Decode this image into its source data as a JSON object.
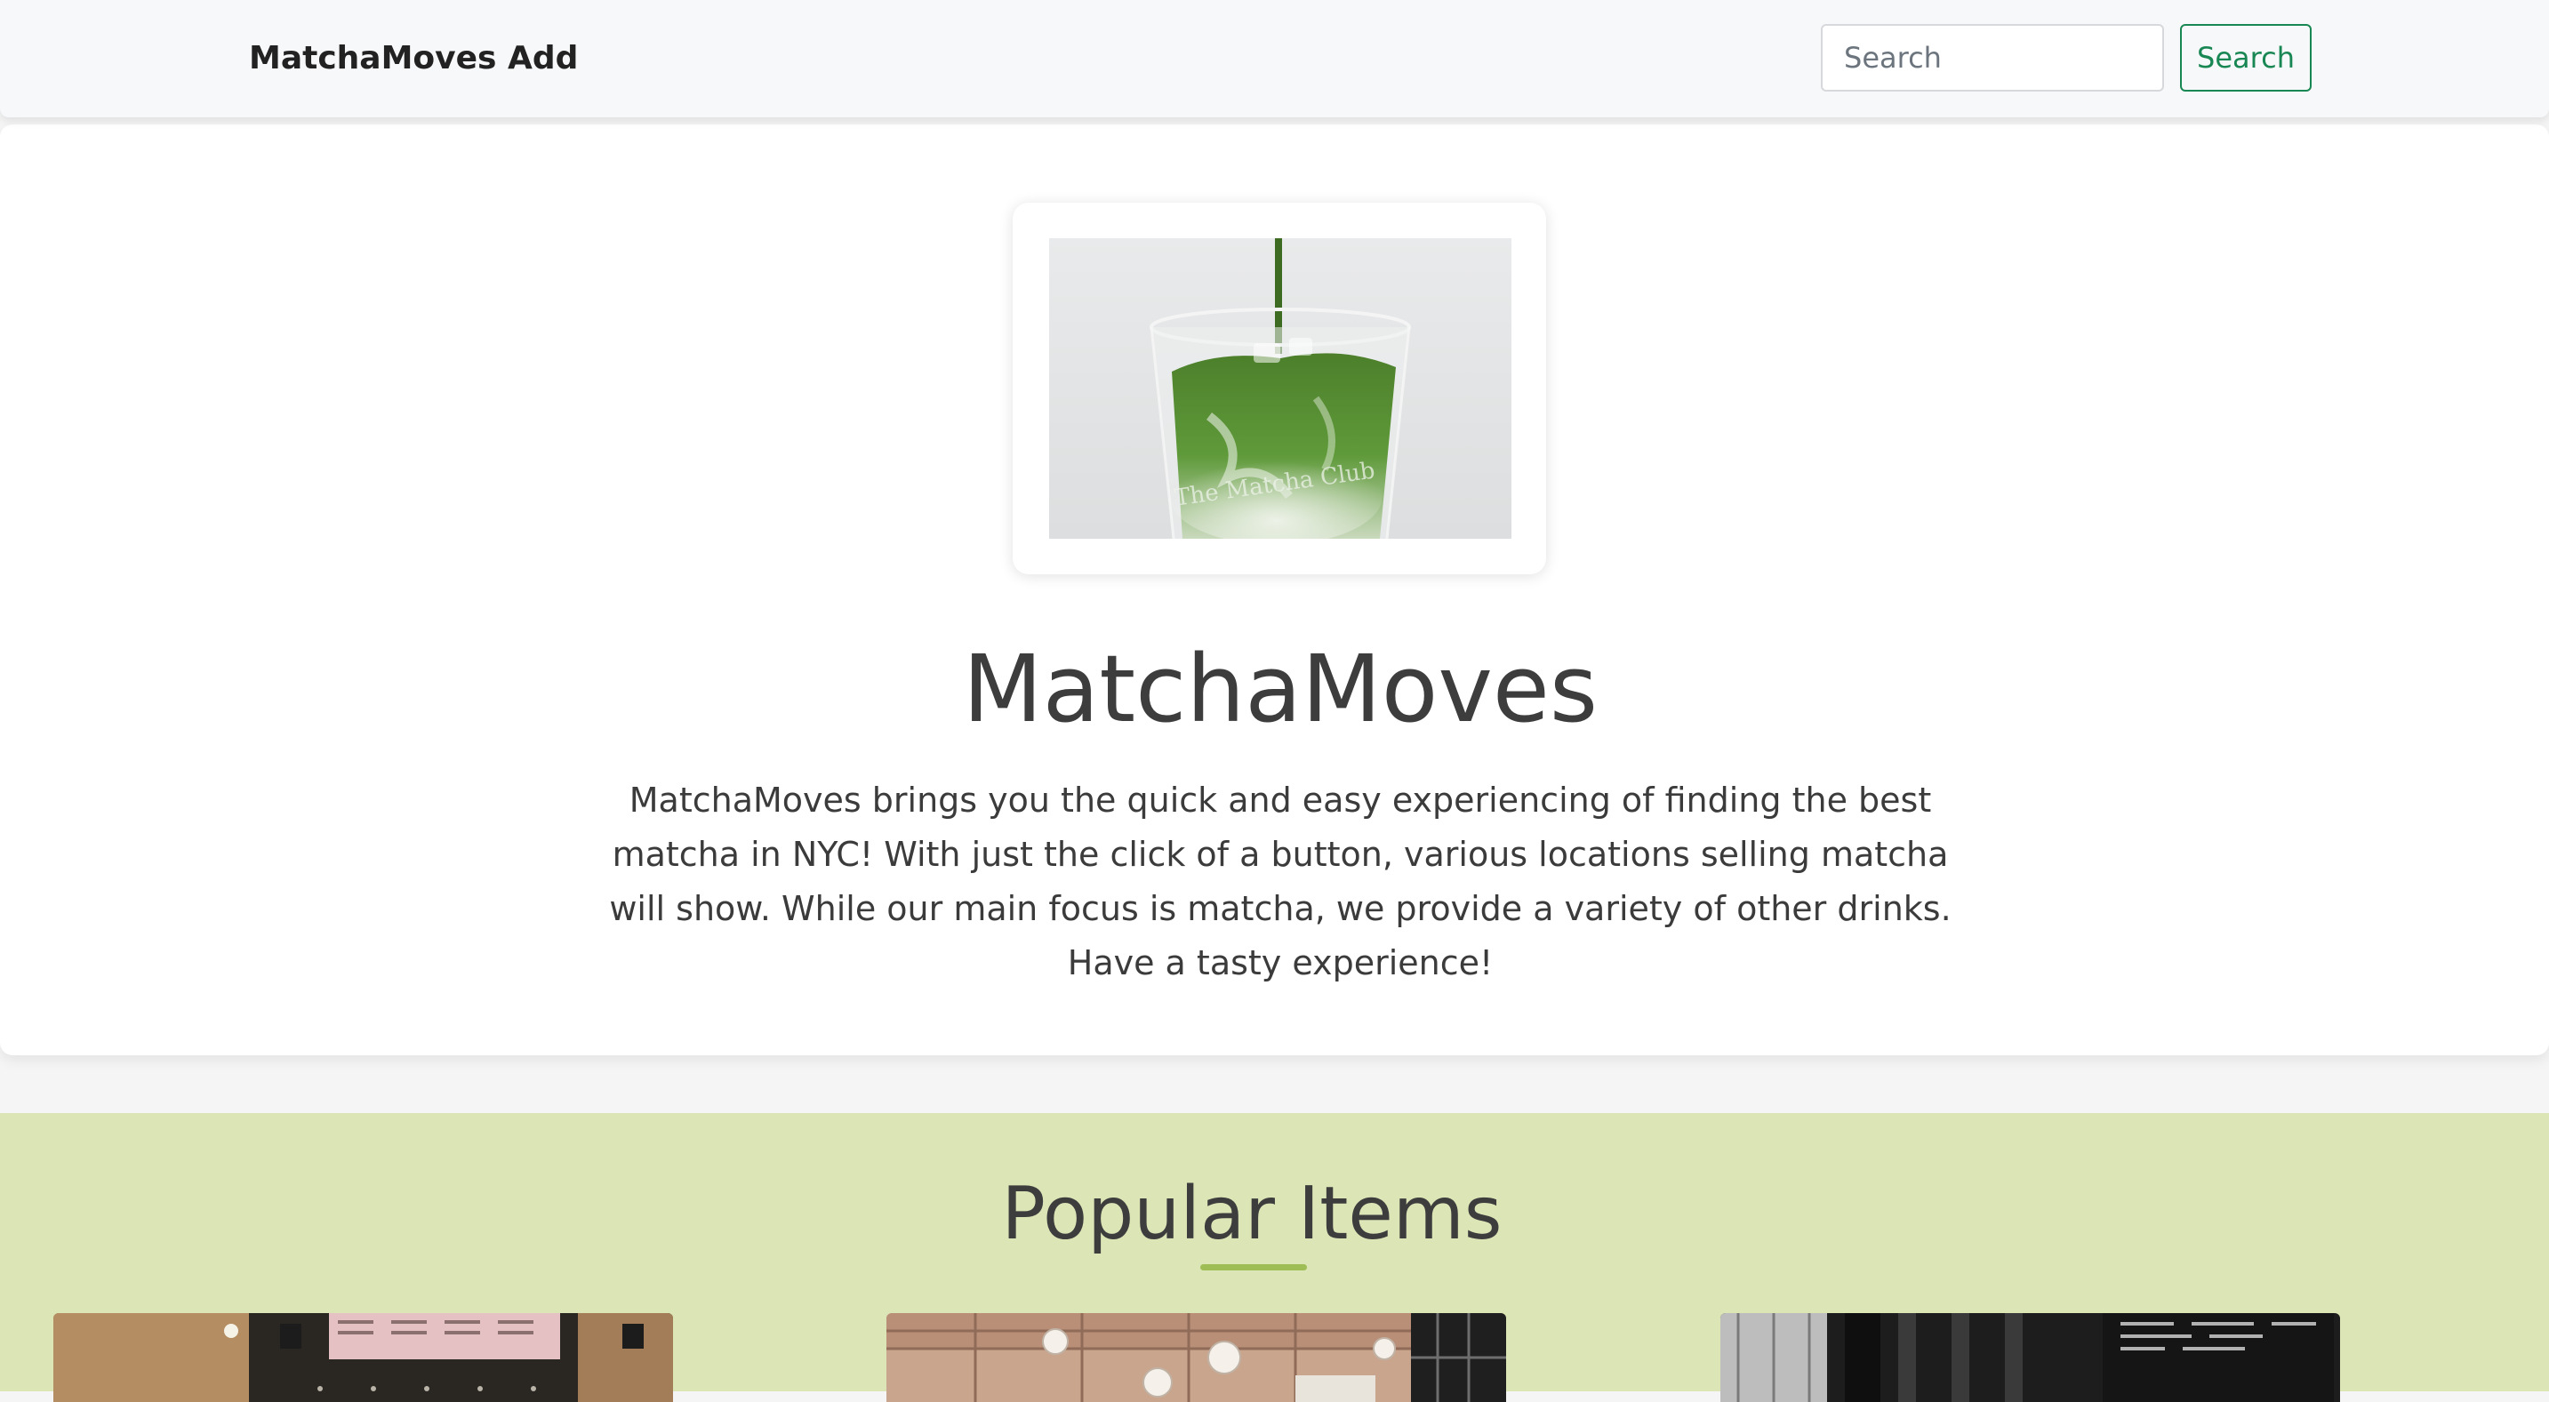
{
  "navbar": {
    "brand": "MatchaMoves",
    "add_link": "Add",
    "search_placeholder": "Search",
    "search_button": "Search"
  },
  "hero": {
    "image_icon": "matcha-latte-image",
    "image_watermark": "The Matcha Club",
    "title": "MatchaMoves",
    "description": "MatchaMoves brings you the quick and easy experiencing of finding the best matcha in NYC! With just the click of a button, various locations selling matcha will show. While our main focus is matcha, we provide a variety of other drinks. Have a tasty experience!"
  },
  "popular": {
    "title": "Popular Items",
    "items": [
      {
        "image_icon": "cafe-counter-photo"
      },
      {
        "image_icon": "cafe-interior-photo"
      },
      {
        "image_icon": "cafe-storefront-photo"
      }
    ]
  },
  "colors": {
    "accent_green": "#198754",
    "popular_bg": "#dce5b6",
    "underline": "#9ebd55"
  }
}
